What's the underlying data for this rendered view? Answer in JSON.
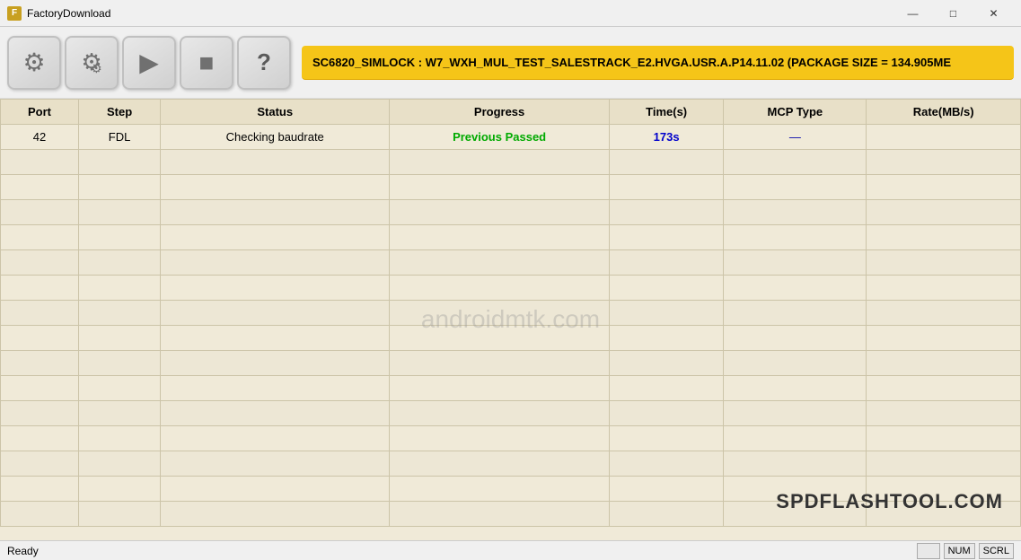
{
  "titleBar": {
    "icon": "F",
    "title": "FactoryDownload",
    "controls": {
      "minimize": "—",
      "maximize": "□",
      "close": "✕"
    }
  },
  "toolbar": {
    "buttons": [
      {
        "id": "settings",
        "icon": "⚙",
        "label": "Settings"
      },
      {
        "id": "advanced",
        "icon": "⚙",
        "label": "Advanced Settings"
      },
      {
        "id": "play",
        "icon": "▶",
        "label": "Play"
      },
      {
        "id": "stop",
        "icon": "■",
        "label": "Stop"
      },
      {
        "id": "help",
        "icon": "?",
        "label": "Help"
      }
    ]
  },
  "headerBanner": {
    "text": "SC6820_SIMLOCK : W7_WXH_MUL_TEST_SALESTRACK_E2.HVGA.USR.A.P14.11.02 (PACKAGE SIZE = 134.905ME"
  },
  "table": {
    "columns": [
      "Port",
      "Step",
      "Status",
      "Progress",
      "Time(s)",
      "MCP Type",
      "Rate(MB/s)"
    ],
    "rows": [
      {
        "port": "42",
        "step": "FDL",
        "status": "Checking baudrate",
        "progress": "Previous Passed",
        "time": "173s",
        "mcpType": "—",
        "rate": ""
      }
    ],
    "emptyRows": 15
  },
  "watermark": "androidmtk.com",
  "branding": "SPDFLASHTOOL.COM",
  "statusBar": {
    "status": "Ready",
    "indicators": [
      "",
      "NUM",
      "SCRL"
    ]
  }
}
